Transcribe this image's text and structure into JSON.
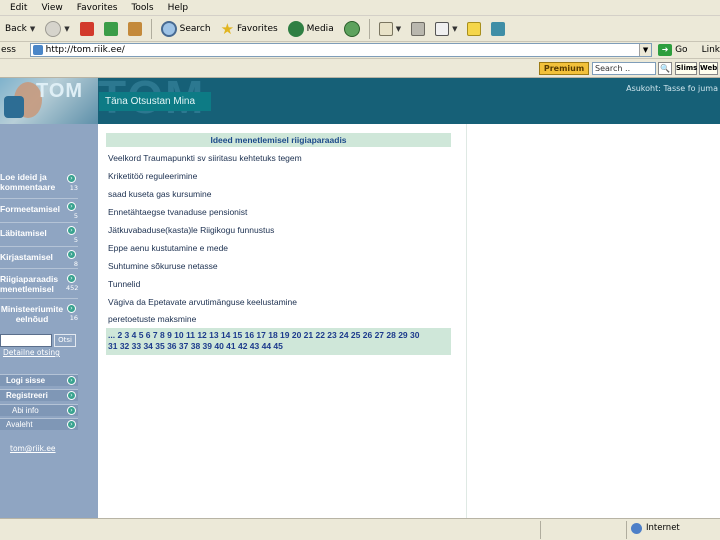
{
  "menu": [
    "Edit",
    "View",
    "Favorites",
    "Tools",
    "Help"
  ],
  "toolbar": {
    "back": "Back",
    "search": "Search",
    "favorites": "Favorites",
    "media": "Media"
  },
  "address": {
    "label": "ess",
    "url": "http://tom.riik.ee/",
    "go": "Go",
    "links": "Link"
  },
  "search_bar": {
    "premium": "Premium",
    "placeholder": "Search ..",
    "btn1": "Slims",
    "btn2": "Web"
  },
  "header": {
    "logo": "TOM",
    "logo_ghost": "TOM",
    "title": "Täna Otsustan Mina",
    "top_link": "Asukoht: Tasse fo juma"
  },
  "sidebar": {
    "items": [
      {
        "label": "Loe ideid ja kommentaare",
        "count": "13"
      },
      {
        "label": "Formeetamisel",
        "count": "5"
      },
      {
        "label": "Läbitamisel",
        "count": "5"
      },
      {
        "label": "Kirjastamisel",
        "count": "8"
      },
      {
        "label": "Riigiaparaadis menetlemisel",
        "count": "452"
      },
      {
        "label": "Ministeeriumite eelnõud",
        "count": "16"
      }
    ],
    "search_button": "Otsi",
    "detail_search": "Detailne otsing",
    "login": "Logi sisse",
    "register": "Registreeri",
    "info": "Abi info",
    "home": "Avaleht",
    "site_link": "tom@riik.ee"
  },
  "main": {
    "heading": "Ideed menetlemisel riigiaparaadis",
    "topics": [
      "Veelkord Traumapunkti sv siiritasu kehtetuks tegem",
      "Kriketitöö reguleerimine",
      "saad kuseta gas kursumine",
      "Ennetähtaegse tvanaduse pensionist",
      "Jätkuvabaduse(kasta)le Riigikogu funnustus",
      "Eppe aenu kustutamine e mede",
      "Suhtumine sõkuruse netasse",
      "Tunnelid",
      "Vägiva da Epetavate arvutimänguse keelustamine",
      "peretoetuste maksmine"
    ],
    "pager": [
      "... 2 3 4 5 6 7 8 9 10 11 12 13 14 15 16 17 18 19 20 21 22 23 24 25 26 27 28 29 30",
      "31 32 33 34 35 36 37 38 39 40 41 42 43 44 45"
    ]
  },
  "status": {
    "zone": "Internet"
  }
}
